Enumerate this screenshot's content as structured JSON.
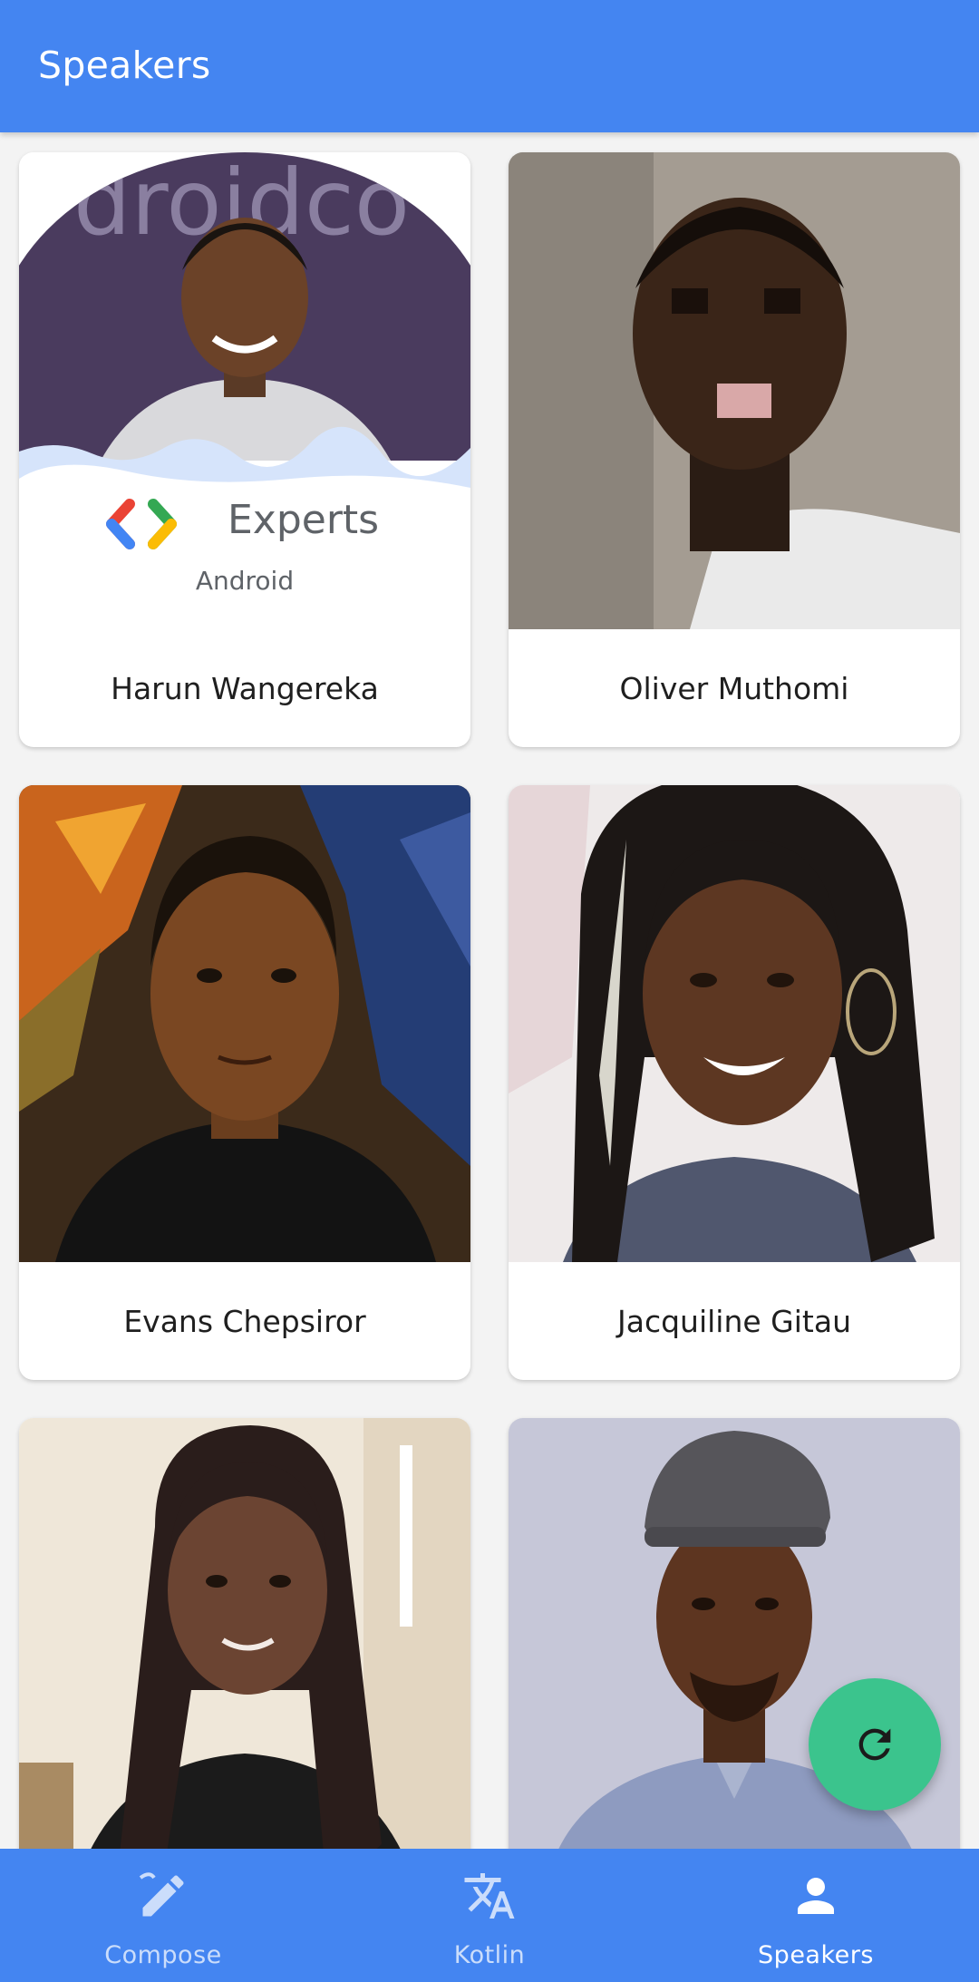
{
  "app_bar": {
    "title": "Speakers"
  },
  "speakers": [
    {
      "name": "Harun Wangereka",
      "badge": {
        "title": "Experts",
        "subtitle": "Android"
      }
    },
    {
      "name": "Oliver Muthomi"
    },
    {
      "name": "Evans Chepsiror"
    },
    {
      "name": "Jacquiline Gitau"
    },
    {
      "name": ""
    },
    {
      "name": ""
    }
  ],
  "fab": {
    "icon": "refresh-icon"
  },
  "bottom_nav": {
    "items": [
      {
        "label": "Compose",
        "icon": "edit-pen-icon",
        "active": false
      },
      {
        "label": "Kotlin",
        "icon": "translate-icon",
        "active": false
      },
      {
        "label": "Speakers",
        "icon": "person-icon",
        "active": true
      }
    ]
  },
  "colors": {
    "primary": "#4485f1",
    "fab": "#3bc48d",
    "background": "#f3f3f3"
  }
}
